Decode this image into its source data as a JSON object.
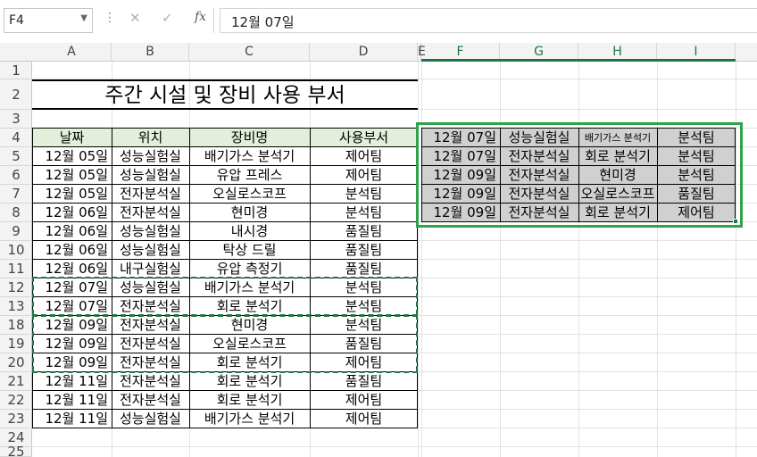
{
  "formula_bar": {
    "name_box": "F4",
    "cancel_icon": "✕",
    "enter_icon": "✓",
    "fx_label": "fx",
    "formula": "12월 07일"
  },
  "columns": [
    "A",
    "B",
    "C",
    "D",
    "E",
    "F",
    "G",
    "H",
    "I"
  ],
  "rows": [
    "1",
    "2",
    "3",
    "4",
    "5",
    "6",
    "7",
    "8",
    "9",
    "10",
    "11",
    "12",
    "13",
    "18",
    "19",
    "20",
    "21",
    "22",
    "23",
    "24",
    "25"
  ],
  "sheet": {
    "title": "주간 시설 및 장비 사용 부서",
    "headers": [
      "날짜",
      "위치",
      "장비명",
      "사용부서"
    ],
    "data": [
      [
        "12월 05일",
        "성능실험실",
        "배기가스 분석기",
        "제어팀"
      ],
      [
        "12월 05일",
        "성능실험실",
        "유압 프레스",
        "제어팀"
      ],
      [
        "12월 05일",
        "전자분석실",
        "오실로스코프",
        "분석팀"
      ],
      [
        "12월 06일",
        "전자분석실",
        "현미경",
        "분석팀"
      ],
      [
        "12월 06일",
        "성능실험실",
        "내시경",
        "품질팀"
      ],
      [
        "12월 06일",
        "성능실험실",
        "탁상 드릴",
        "품질팀"
      ],
      [
        "12월 06일",
        "내구실험실",
        "유압 측정기",
        "품질팀"
      ],
      [
        "12월 07일",
        "성능실험실",
        "배기가스 분석기",
        "분석팀"
      ],
      [
        "12월 07일",
        "전자분석실",
        "회로 분석기",
        "분석팀"
      ],
      [
        "12월 09일",
        "전자분석실",
        "현미경",
        "분석팀"
      ],
      [
        "12월 09일",
        "전자분석실",
        "오실로스코프",
        "품질팀"
      ],
      [
        "12월 09일",
        "전자분석실",
        "회로 분석기",
        "제어팀"
      ],
      [
        "12월 11일",
        "전자분석실",
        "회로 분석기",
        "품질팀"
      ],
      [
        "12월 11일",
        "전자분석실",
        "회로 분석기",
        "제어팀"
      ],
      [
        "12월 11일",
        "성능실험실",
        "배기가스 분석기",
        "제어팀"
      ]
    ],
    "pasted": [
      [
        "12월 07일",
        "성능실험실",
        "배기가스 분석기",
        "분석팀"
      ],
      [
        "12월 07일",
        "전자분석실",
        "회로 분석기",
        "분석팀"
      ],
      [
        "12월 09일",
        "전자분석실",
        "현미경",
        "분석팀"
      ],
      [
        "12월 09일",
        "전자분석실",
        "오실로스코프",
        "품질팀"
      ],
      [
        "12월 09일",
        "전자분석실",
        "회로 분석기",
        "제어팀"
      ]
    ]
  },
  "colors": {
    "accent": "#217346",
    "selection_outline": "#2fa24a",
    "header_fill": "#e2efda",
    "paste_fill": "#d0d0d0"
  }
}
